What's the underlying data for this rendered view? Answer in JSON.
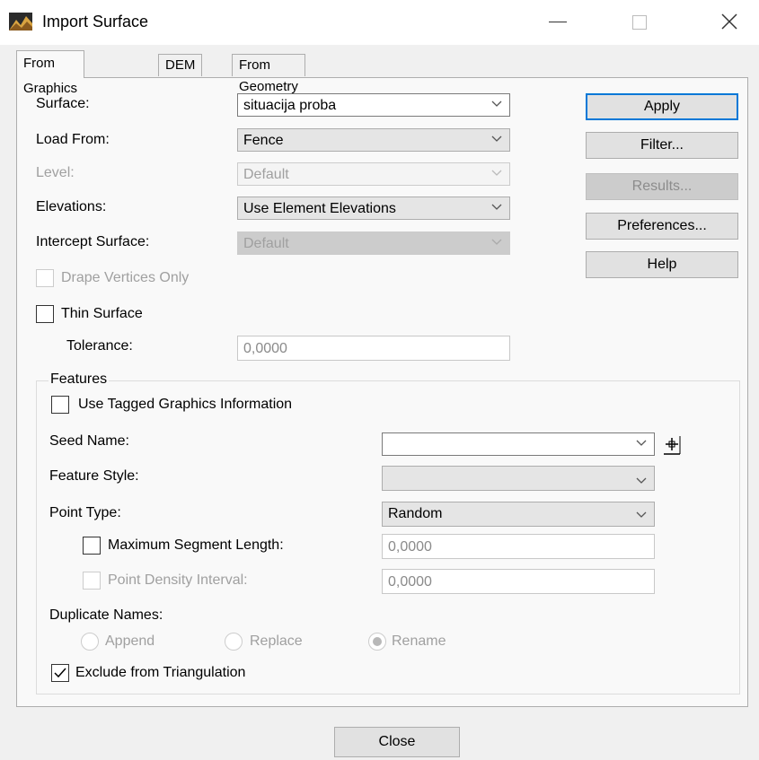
{
  "window": {
    "title": "Import Surface",
    "icon": "import-surface-icon"
  },
  "tabs": [
    {
      "label": "From Graphics",
      "active": true
    },
    {
      "label": "DEM",
      "active": false
    },
    {
      "label": "From Geometry",
      "active": false
    }
  ],
  "form": {
    "surface": {
      "label": "Surface:",
      "value": "situacija proba"
    },
    "load_from": {
      "label": "Load From:",
      "value": "Fence"
    },
    "level": {
      "label": "Level:",
      "value": "Default",
      "enabled": false
    },
    "elevations": {
      "label": "Elevations:",
      "value": "Use Element Elevations"
    },
    "intercept_surface": {
      "label": "Intercept Surface:",
      "value": "Default",
      "enabled": false
    },
    "drape_vertices_only": {
      "label": "Drape Vertices Only",
      "checked": false,
      "enabled": false
    },
    "thin_surface": {
      "label": "Thin Surface",
      "checked": false
    },
    "tolerance": {
      "label": "Tolerance:",
      "value": "0,0000",
      "enabled": false
    }
  },
  "buttons": {
    "apply": "Apply",
    "filter": "Filter...",
    "results": "Results...",
    "preferences": "Preferences...",
    "help": "Help",
    "close": "Close"
  },
  "features": {
    "title": "Features",
    "use_tagged": {
      "label": "Use Tagged Graphics Information",
      "checked": false
    },
    "seed_name": {
      "label": "Seed Name:",
      "value": ""
    },
    "feature_style": {
      "label": "Feature Style:",
      "value": ""
    },
    "point_type": {
      "label": "Point Type:",
      "value": "Random"
    },
    "max_segment_length": {
      "label": "Maximum Segment Length:",
      "checked": false,
      "value": "0,0000"
    },
    "point_density_interval": {
      "label": "Point Density Interval:",
      "checked": false,
      "enabled": false,
      "value": "0,0000"
    },
    "duplicate_names": {
      "label": "Duplicate Names:",
      "options": [
        "Append",
        "Replace",
        "Rename"
      ],
      "selected": "Rename",
      "enabled": false
    },
    "exclude_triangulation": {
      "label": "Exclude from Triangulation",
      "checked": true
    }
  },
  "colors": {
    "accent": "#0078d7",
    "dialog_bg": "#f0f0f0",
    "disabled_text": "#a0a0a0"
  }
}
